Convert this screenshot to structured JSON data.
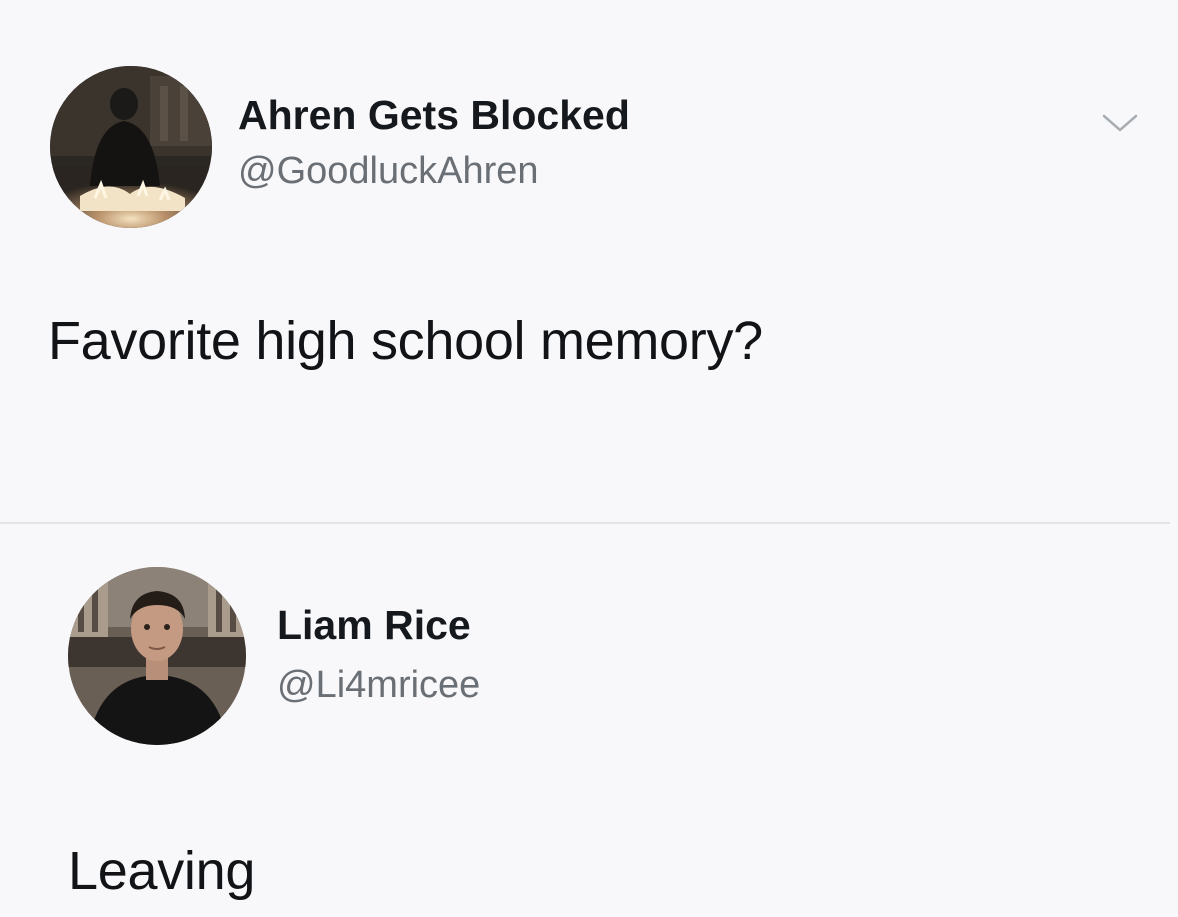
{
  "tweet": {
    "author": {
      "display_name": "Ahren Gets Blocked",
      "handle": "@GoodluckAhren",
      "avatar_icon": "profile-photo"
    },
    "text": "Favorite high school memory?",
    "menu_icon": "chevron-down-icon"
  },
  "reply": {
    "author": {
      "display_name": "Liam Rice",
      "handle": "@Li4mricee",
      "avatar_icon": "profile-photo"
    },
    "text": "Leaving"
  },
  "colors": {
    "background": "#f8f8fa",
    "primary_text": "#14171a",
    "secondary_text": "#6a6f75",
    "divider": "#e3e4e8"
  }
}
